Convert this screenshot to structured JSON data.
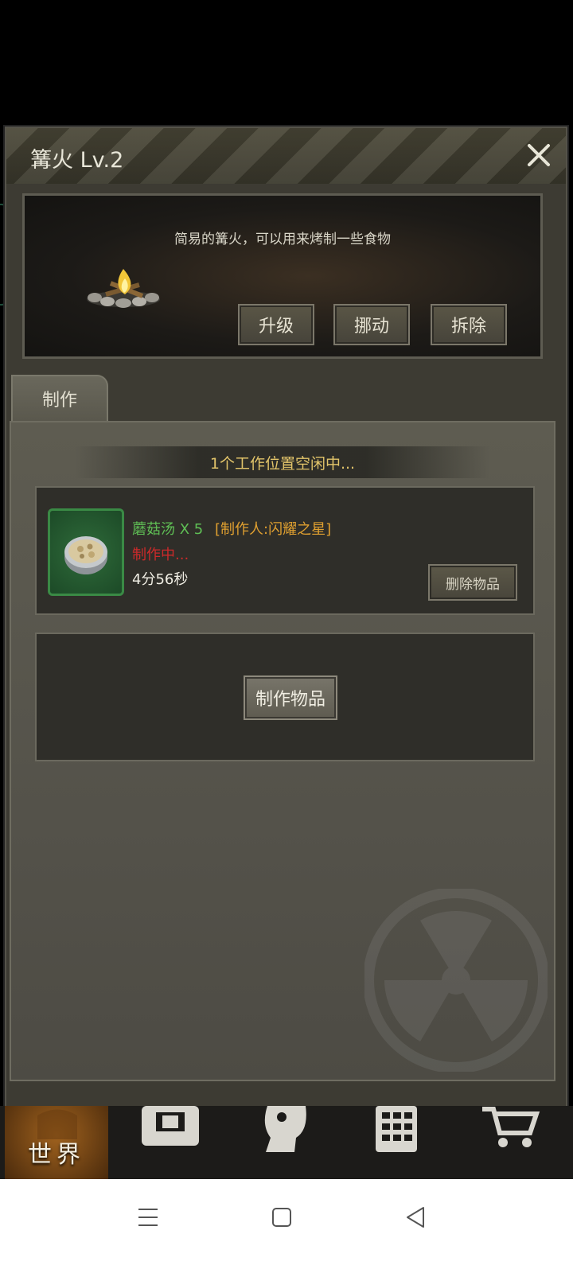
{
  "modal": {
    "title": "篝火 Lv.2",
    "description": "简易的篝火，可以用来烤制一些食物",
    "actions": {
      "upgrade": "升级",
      "move": "挪动",
      "dismantle": "拆除"
    }
  },
  "tabs": [
    {
      "label": "制作"
    }
  ],
  "crafting": {
    "status": "1个工作位置空闲中...",
    "job": {
      "item": "蘑菇汤 X 5",
      "maker": "[制作人:闪耀之星]",
      "state": "制作中...",
      "remaining": "4分56秒",
      "delete_label": "删除物品"
    },
    "craft_button": "制作物品"
  },
  "game_nav": {
    "world_label": "世界",
    "icons": [
      "globe-icon",
      "backpack-icon",
      "head-icon",
      "calculator-icon",
      "cart-icon"
    ]
  },
  "system_nav": {
    "icons": [
      "menu-icon",
      "home-icon",
      "back-icon"
    ]
  },
  "colors": {
    "item_name": "#5fbf55",
    "maker": "#e0a030",
    "in_progress": "#cc2a2a",
    "status": "#e2c46a"
  }
}
